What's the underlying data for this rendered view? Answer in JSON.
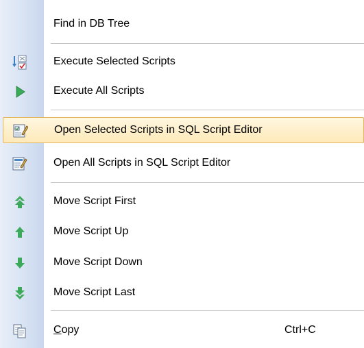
{
  "menu": {
    "items": [
      {
        "label": "Find in DB Tree",
        "icon": "none"
      },
      {
        "label": "Execute Selected Scripts",
        "icon": "execute-selected-icon"
      },
      {
        "label": "Execute All Scripts",
        "icon": "play-icon"
      },
      {
        "label": "Open Selected Scripts in SQL Script Editor",
        "icon": "open-selected-editor-icon",
        "highlighted": true
      },
      {
        "label": "Open All Scripts in SQL Script Editor",
        "icon": "open-editor-icon"
      },
      {
        "label": "Move Script First",
        "icon": "double-arrow-up-icon"
      },
      {
        "label": "Move Script Up",
        "icon": "arrow-up-icon"
      },
      {
        "label": "Move Script Down",
        "icon": "arrow-down-icon"
      },
      {
        "label": "Move Script Last",
        "icon": "double-arrow-down-icon"
      },
      {
        "label_prefix": "C",
        "label_rest": "opy",
        "shortcut": "Ctrl+C",
        "icon": "copy-icon"
      }
    ]
  },
  "colors": {
    "highlight_border": "#e3b55f",
    "highlight_fill": "#fee9b8",
    "arrow_green": "#3caa5a",
    "gutter": "#dbe5f4"
  }
}
